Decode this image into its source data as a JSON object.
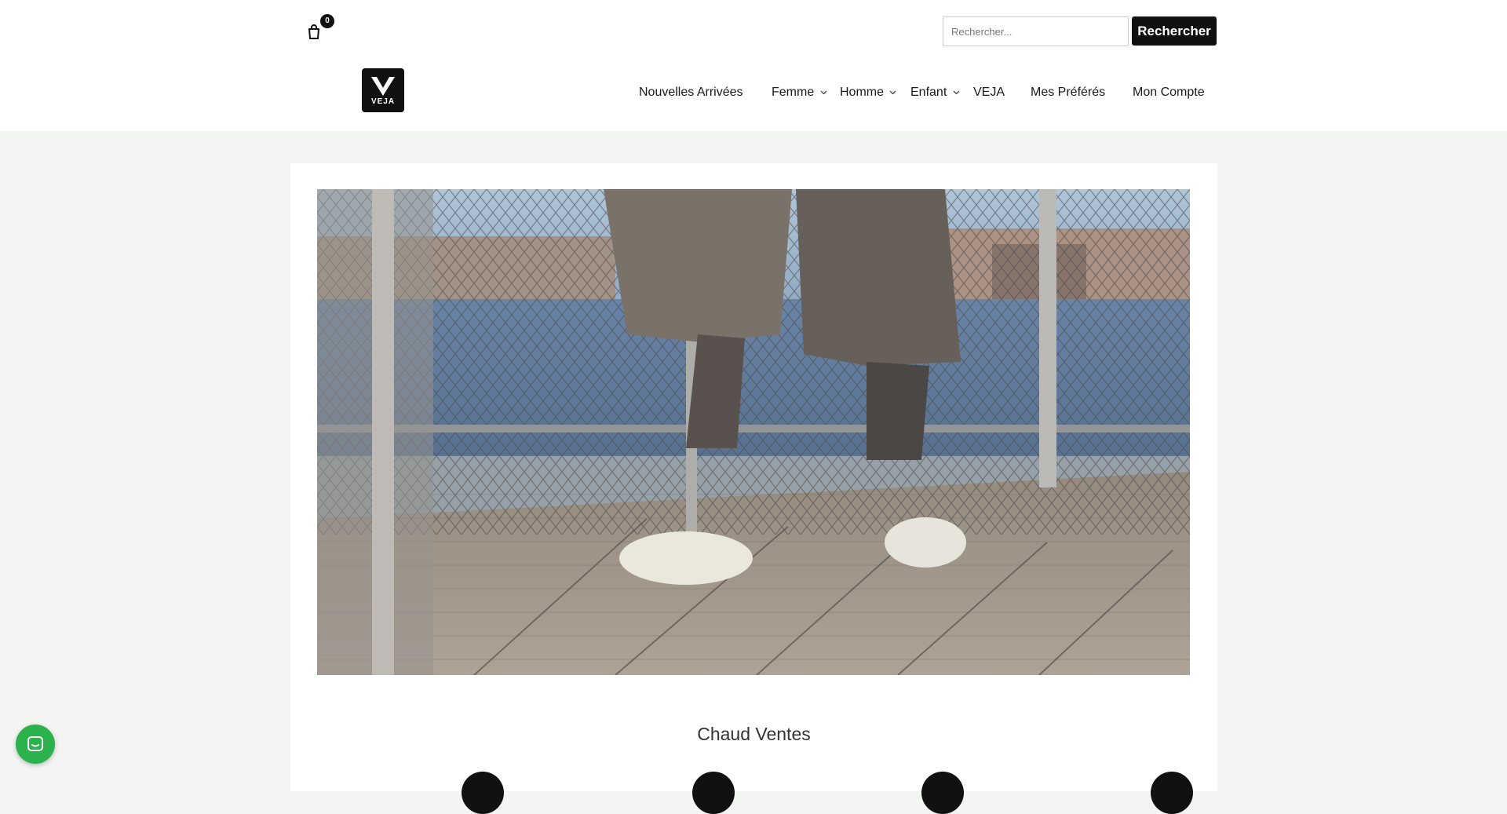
{
  "header": {
    "cart": {
      "icon": "shopping-bag-icon",
      "count": "0"
    },
    "search": {
      "placeholder": "Rechercher...",
      "value": "",
      "button_label": "Rechercher"
    },
    "logo": {
      "text": "VEJA"
    },
    "nav": [
      {
        "label": "Nouvelles Arrivées",
        "has_dropdown": false
      },
      {
        "label": "Femme",
        "has_dropdown": true
      },
      {
        "label": "Homme",
        "has_dropdown": true
      },
      {
        "label": "Enfant",
        "has_dropdown": true
      },
      {
        "label": "VEJA",
        "has_dropdown": false
      },
      {
        "label": "Mes Préférés",
        "has_dropdown": false
      },
      {
        "label": "Mon Compte",
        "has_dropdown": false
      }
    ]
  },
  "main": {
    "section_title": "Chaud Ventes"
  },
  "chat": {
    "icon": "chat-icon"
  },
  "colors": {
    "page_background": "#f3f5f2",
    "chat_green": "#2bb24c",
    "button_black": "#111111"
  }
}
